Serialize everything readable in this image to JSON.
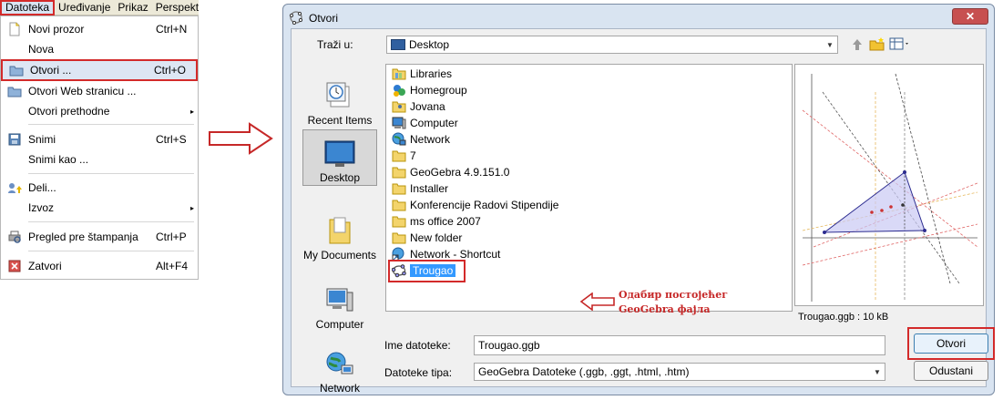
{
  "menubar": {
    "items": [
      "Datoteka",
      "Uređivanje",
      "Prikaz",
      "Perspekt"
    ]
  },
  "menu": {
    "items": [
      {
        "label": "Novi prozor",
        "shortcut": "Ctrl+N",
        "icon": "new-window-icon"
      },
      {
        "label": "Nova",
        "shortcut": "",
        "icon": ""
      },
      {
        "label": "Otvori ...",
        "shortcut": "Ctrl+O",
        "icon": "open-folder-icon"
      },
      {
        "label": "Otvori Web stranicu ...",
        "shortcut": "",
        "icon": "open-folder-icon"
      },
      {
        "label": "Otvori prethodne",
        "shortcut": "",
        "icon": ""
      },
      {
        "label": "Snimi",
        "shortcut": "Ctrl+S",
        "icon": "save-icon"
      },
      {
        "label": "Snimi kao ...",
        "shortcut": "",
        "icon": ""
      },
      {
        "label": "Deli...",
        "shortcut": "",
        "icon": "share-icon"
      },
      {
        "label": "Izvoz",
        "shortcut": "",
        "icon": ""
      },
      {
        "label": "Pregled pre štampanja",
        "shortcut": "Ctrl+P",
        "icon": "print-preview-icon"
      },
      {
        "label": "Zatvori",
        "shortcut": "Alt+F4",
        "icon": "close-icon"
      }
    ],
    "submenu_arrow": "▸"
  },
  "dialog": {
    "title": "Otvori",
    "close": "✕",
    "look_in_label": "Traži u:",
    "look_in_value": "Desktop",
    "places": [
      "Recent Items",
      "Desktop",
      "My Documents",
      "Computer",
      "Network"
    ],
    "files": [
      {
        "name": "Libraries",
        "icon": "libraries-icon"
      },
      {
        "name": "Homegroup",
        "icon": "homegroup-icon"
      },
      {
        "name": "Jovana",
        "icon": "user-folder-icon"
      },
      {
        "name": "Computer",
        "icon": "computer-icon"
      },
      {
        "name": "Network",
        "icon": "network-icon"
      },
      {
        "name": "7",
        "icon": "folder-icon"
      },
      {
        "name": "GeoGebra 4.9.151.0",
        "icon": "folder-icon"
      },
      {
        "name": "Installer",
        "icon": "folder-icon"
      },
      {
        "name": "Konferencije Radovi Stipendije",
        "icon": "folder-icon"
      },
      {
        "name": "ms office 2007",
        "icon": "folder-icon"
      },
      {
        "name": "New folder",
        "icon": "folder-icon"
      },
      {
        "name": "Network - Shortcut",
        "icon": "shortcut-icon"
      },
      {
        "name": "Trougao",
        "icon": "geogebra-file-icon"
      }
    ],
    "annotation": [
      "Одабир постојећег",
      "GeoGebra фајла"
    ],
    "preview_caption": "Trougao.ggb : 10 kB",
    "file_name_label": "Ime datoteke:",
    "file_name_value": "Trougao.ggb",
    "file_type_label": "Datoteke tipa:",
    "file_type_value": "GeoGebra Datoteke (.ggb, .ggt, .html, .htm)",
    "open_button": "Otvori",
    "cancel_button": "Odustani"
  },
  "colors": {
    "highlight_red": "#d32a2a",
    "selection_blue": "#3399ff"
  }
}
